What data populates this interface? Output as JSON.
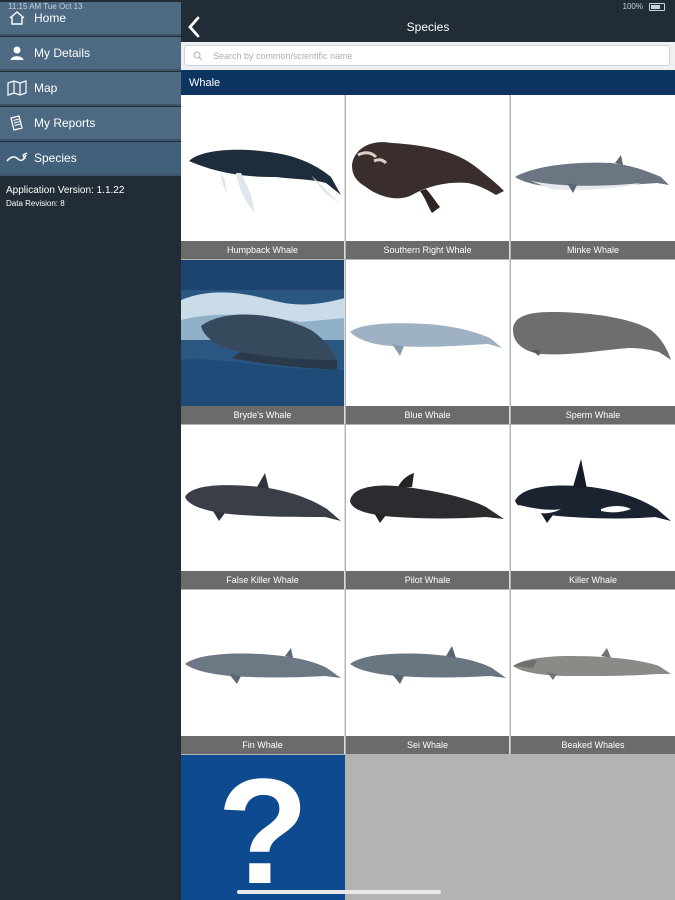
{
  "status_bar": {
    "time": "11:15 AM   Tue Oct 13",
    "battery": "100%"
  },
  "sidebar": {
    "items": [
      {
        "label": "Home",
        "icon": "home-icon"
      },
      {
        "label": "My Details",
        "icon": "user-icon"
      },
      {
        "label": "Map",
        "icon": "map-icon"
      },
      {
        "label": "My Reports",
        "icon": "reports-icon"
      },
      {
        "label": "Species",
        "icon": "species-icon"
      }
    ],
    "version": "Application Version: 1.1.22",
    "data_revision": "Data Revision: 8"
  },
  "header": {
    "title": "Species",
    "back": "back-chevron-icon"
  },
  "search": {
    "placeholder": "Search by common/scientific name"
  },
  "section": {
    "title": "Whale"
  },
  "species": [
    {
      "name": "Humpback Whale"
    },
    {
      "name": "Southern Right Whale"
    },
    {
      "name": "Minke Whale"
    },
    {
      "name": "Bryde's Whale"
    },
    {
      "name": "Blue Whale"
    },
    {
      "name": "Sperm Whale"
    },
    {
      "name": "False Killer Whale"
    },
    {
      "name": "Pilot Whale"
    },
    {
      "name": "Killer Whale"
    },
    {
      "name": "Fin Whale"
    },
    {
      "name": "Sei Whale"
    },
    {
      "name": "Beaked Whales"
    }
  ],
  "unknown_tile": {
    "glyph": "?"
  },
  "colors": {
    "nav": "#4d6a82",
    "header": "#222c36",
    "section": "#0e3461",
    "caption": "#6b6b6b",
    "unknown": "#0d4a8f"
  }
}
